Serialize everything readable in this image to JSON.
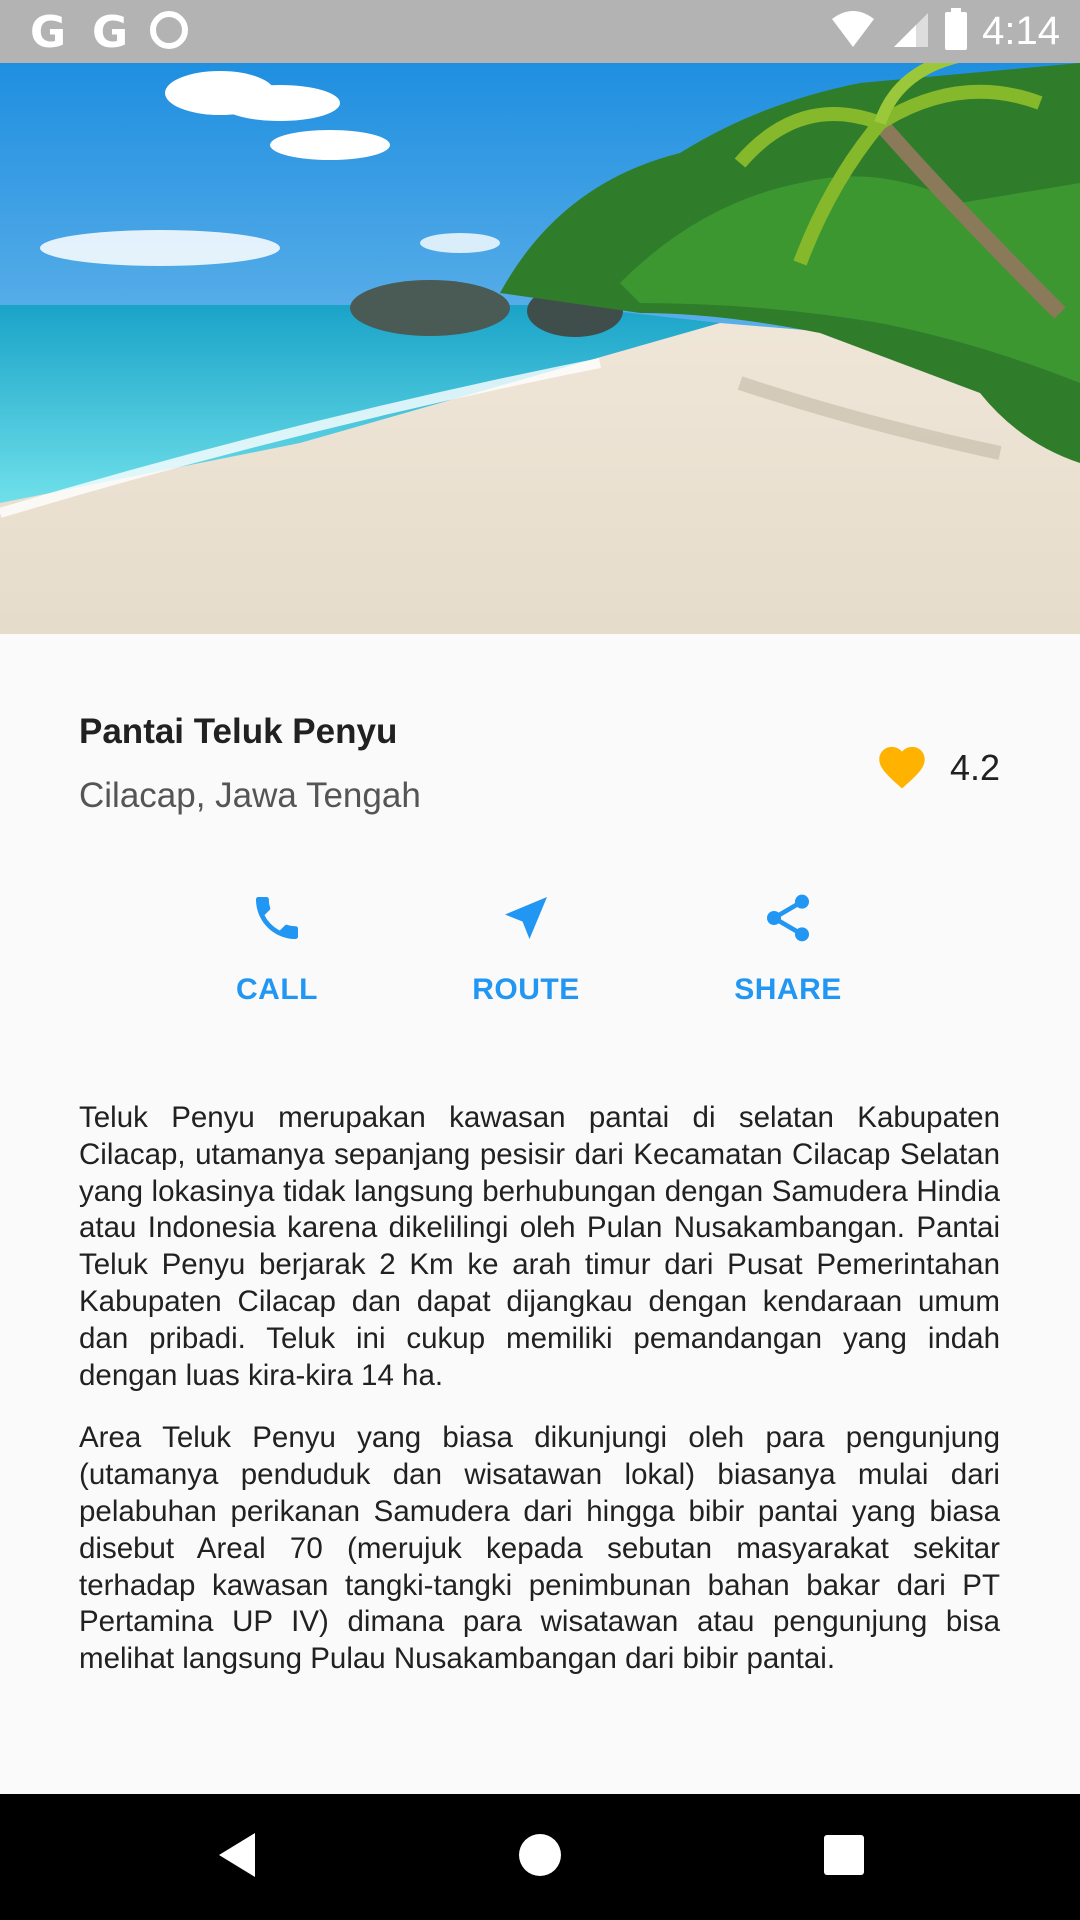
{
  "status_bar": {
    "left_icons": [
      "G",
      "G"
    ],
    "time": "4:14"
  },
  "place": {
    "name": "Pantai Teluk Penyu",
    "location": "Cilacap, Jawa Tengah",
    "rating": "4.2",
    "rating_icon": "heart-icon",
    "rating_color": "#FFB300"
  },
  "actions": {
    "call_label": "CALL",
    "route_label": "ROUTE",
    "share_label": "SHARE",
    "accent_color": "#2196F3"
  },
  "description": {
    "paragraph_1": "Teluk Penyu merupakan kawasan pantai di selatan Kabupaten Cilacap, utamanya sepanjang pesisir dari Kecamatan Cilacap Selatan yang lokasinya tidak langsung berhubungan dengan Samudera Hindia atau Indonesia karena dikelilingi oleh Pulan Nusakambangan. Pantai Teluk Penyu berjarak 2 Km ke arah timur dari Pusat Pemerintahan Kabupaten Cilacap dan dapat dijangkau dengan kendaraan umum dan pribadi. Teluk ini cukup memiliki pemandangan yang indah dengan luas kira-kira 14 ha.",
    "paragraph_2": "Area Teluk Penyu yang biasa dikunjungi oleh para pengunjung (utamanya penduduk dan wisatawan lokal) biasanya mulai dari pelabuhan perikanan Samudera dari hingga bibir pantai yang biasa disebut Areal 70 (merujuk kepada sebutan masyarakat sekitar terhadap kawasan tangki-tangki penimbunan bahan bakar dari PT Pertamina UP IV) dimana para wisatawan atau pengunjung bisa melihat langsung Pulau Nusakambangan dari bibir pantai."
  },
  "nav_bar": {
    "back_icon": "back-triangle-icon",
    "home_icon": "home-circle-icon",
    "recents_icon": "recents-square-icon"
  }
}
